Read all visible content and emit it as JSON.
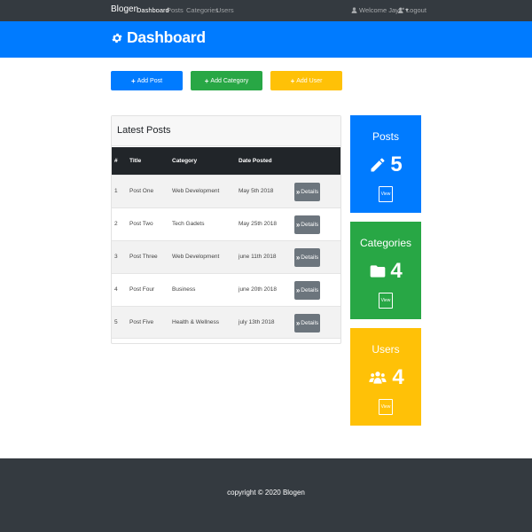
{
  "navbar": {
    "brand": "Blogen",
    "links": [
      {
        "label": "Dashboard",
        "active": true
      },
      {
        "label": "Posts",
        "active": false
      },
      {
        "label": "Categories",
        "active": false
      },
      {
        "label": "Users",
        "active": false
      }
    ],
    "welcome": "Welcome Jay!",
    "logout": "Logout"
  },
  "header": {
    "title": "Dashboard",
    "icon": "cog-icon"
  },
  "actions": {
    "add_post": "Add Post",
    "add_category": "Add Category",
    "add_user": "Add User"
  },
  "posts_card": {
    "title": "Latest Posts",
    "columns": [
      "#",
      "Title",
      "Category",
      "Date Posted"
    ],
    "details_label": "Details",
    "rows": [
      {
        "num": "1",
        "title": "Post One",
        "category": "Web Development",
        "date": "May 5th 2018"
      },
      {
        "num": "2",
        "title": "Post Two",
        "category": "Tech Gadets",
        "date": "May 25th 2018"
      },
      {
        "num": "3",
        "title": "Post Three",
        "category": "Web Development",
        "date": "june 11th 2018"
      },
      {
        "num": "4",
        "title": "Post Four",
        "category": "Business",
        "date": "june 20th 2018"
      },
      {
        "num": "5",
        "title": "Post Five",
        "category": "Health & Wellness",
        "date": "july 13th 2018"
      }
    ]
  },
  "stats": [
    {
      "title": "Posts",
      "count": "5",
      "view": "View",
      "icon": "pencil-icon",
      "color": "#007bff"
    },
    {
      "title": "Categories",
      "count": "4",
      "view": "View",
      "icon": "folder-icon",
      "color": "#28a745"
    },
    {
      "title": "Users",
      "count": "4",
      "view": "View",
      "icon": "users-icon",
      "color": "#ffc107"
    }
  ],
  "footer": {
    "text": "copyright © 2020 Blogen"
  },
  "colors": {
    "primary": "#007bff",
    "success": "#28a745",
    "warning": "#ffc107",
    "dark": "#343a40",
    "secondary": "#6c757d"
  }
}
